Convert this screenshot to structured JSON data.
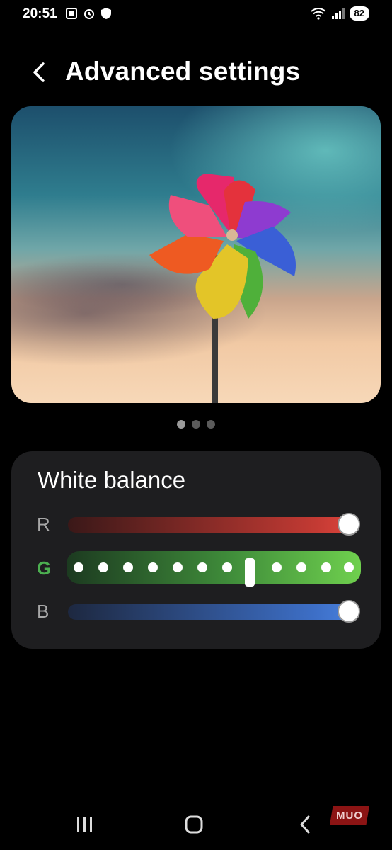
{
  "status_bar": {
    "time": "20:51",
    "battery": "82",
    "icons": [
      "screen-record-icon",
      "alarm-icon",
      "shield-icon",
      "wifi-icon",
      "signal-icon"
    ]
  },
  "header": {
    "title": "Advanced settings",
    "back_icon": "chevron-left-icon"
  },
  "preview": {
    "pages": 3,
    "active_page": 1
  },
  "white_balance": {
    "title": "White balance",
    "channels": [
      {
        "label": "R",
        "level": 1.0,
        "color": "#e0473e",
        "active": false
      },
      {
        "label": "G",
        "level": 0.64,
        "color": "#6fd04e",
        "active": true
      },
      {
        "label": "B",
        "level": 1.0,
        "color": "#4b83e0",
        "active": false
      }
    ]
  },
  "navbar": {
    "recents_icon": "recents-icon",
    "home_icon": "home-icon",
    "back_icon": "back-icon"
  },
  "watermark": "MUO"
}
